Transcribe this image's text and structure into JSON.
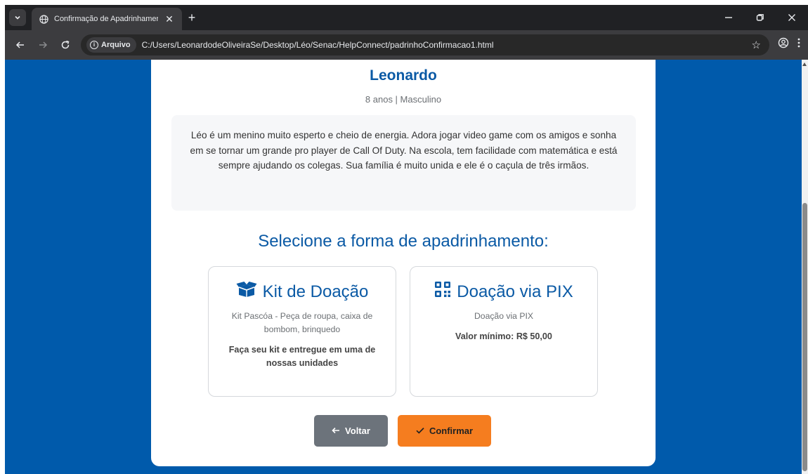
{
  "browser": {
    "tab": {
      "title": "Confirmação de Apadrinhamento"
    },
    "new_tab_glyph": "+",
    "address": {
      "chip_label": "Arquivo",
      "url": "C:/Users/LeonardodeOliveiraSe/Desktop/Léo/Senac/HelpConnect/padrinhoConfirmacao1.html"
    },
    "icons": [
      "tab-search-icon",
      "globe-icon",
      "close-icon",
      "back-arrow-icon",
      "forward-arrow-icon",
      "reload-icon",
      "info-icon",
      "star-icon",
      "profile-icon",
      "menu-kebab-icon",
      "minimize-icon",
      "restore-icon"
    ]
  },
  "child": {
    "name": "Leonardo",
    "meta": "8 anos | Masculino",
    "bio": "Léo é um menino muito esperto e cheio de energia. Adora jogar video game com os amigos e sonha em se tornar um grande pro player de Call Of Duty. Na escola, tem facilidade com matemática e está sempre ajudando os colegas. Sua família é muito unida e ele é o caçula de três irmãos."
  },
  "selection": {
    "title": "Selecione a forma de apadrinhamento:",
    "options": [
      {
        "title": "Kit de Doação",
        "icon": "box-open-icon",
        "description": "Kit Pascóa - Peça de roupa, caixa de bombom, brinquedo",
        "note": "Faça seu kit e entregue em uma de nossas unidades"
      },
      {
        "title": "Doação via PIX",
        "icon": "qr-code-icon",
        "description": "Doação via PIX",
        "note": "Valor mínimo: R$ 50,00"
      }
    ]
  },
  "actions": {
    "back_label": "Voltar",
    "confirm_label": "Confirmar"
  },
  "colors": {
    "page_background": "#005aab",
    "accent_blue": "#0b5aa5",
    "back_button": "#6c737b",
    "confirm_button": "#f57d1f"
  }
}
